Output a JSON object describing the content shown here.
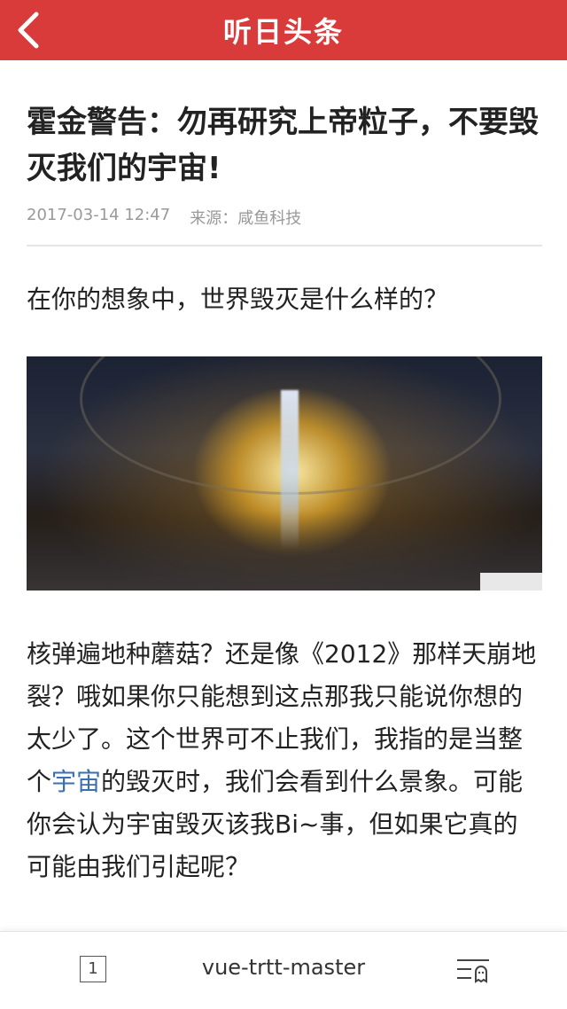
{
  "header": {
    "title": "听日头条",
    "back_icon": "chevron-left-icon",
    "bg_color": "#d93a3a"
  },
  "article": {
    "title": "霍金警告：勿再研究上帝粒子，不要毁灭我们的宇宙!",
    "date": "2017-03-14 12:47",
    "source": "来源：咸鱼科技",
    "lead": "在你的想象中，世界毁灭是什么样的？",
    "body_before": "核弹遍地种蘑菇？还是像《2012》那样天崩地裂？哦如果你只能想到这点那我只能说你想的太少了。这个世界可不止我们，我指的是当整个",
    "body_link": "宇宙",
    "body_after": "的毁灭时，我们会看到什么景象。可能你会认为宇宙毁灭该我Bi~事，但如果它真的可能由我们引起呢？",
    "link_color": "#3a6fb0"
  },
  "bottom_bar": {
    "tab_count": "1",
    "label": "vue-trtt-master",
    "menu_icon": "menu-icon"
  }
}
